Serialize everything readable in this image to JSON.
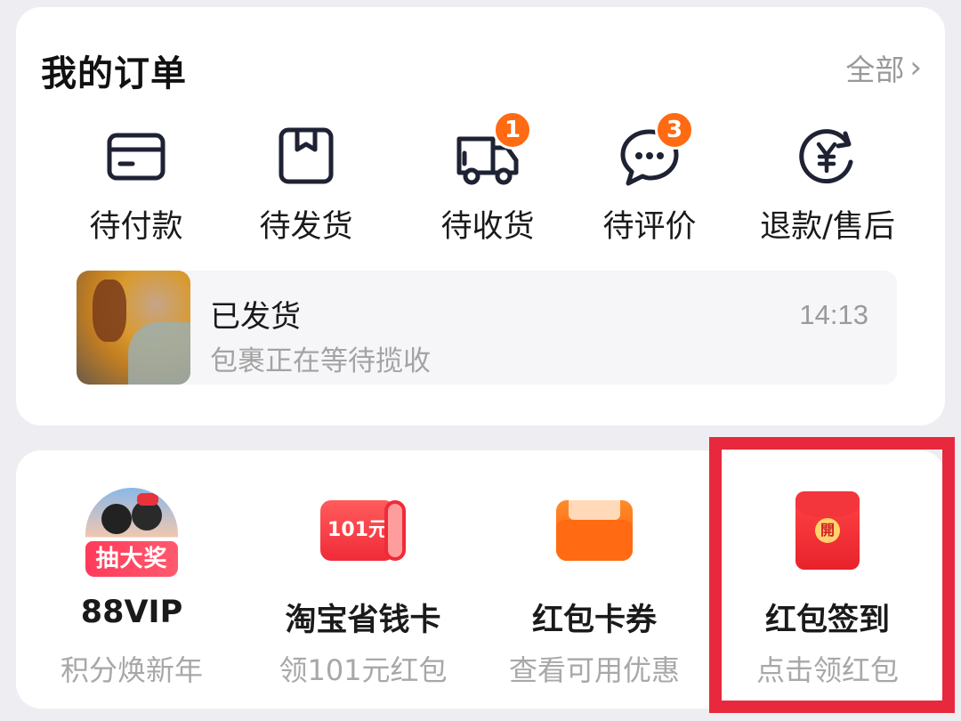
{
  "orders": {
    "title": "我的订单",
    "see_all": "全部",
    "statuses": [
      {
        "label": "待付款",
        "icon": "card-icon"
      },
      {
        "label": "待发货",
        "icon": "box-icon"
      },
      {
        "label": "待收货",
        "icon": "truck-icon",
        "badge": "1"
      },
      {
        "label": "待评价",
        "icon": "chat-bubble-icon",
        "badge": "3"
      },
      {
        "label": "退款/售后",
        "icon": "refund-yen-icon"
      }
    ],
    "latest": {
      "title": "已发货",
      "subtitle": "包裹正在等待揽收",
      "time": "14:13"
    }
  },
  "tools": [
    {
      "name": "88VIP",
      "subtitle": "积分焕新年",
      "icon": "vip-lottery-icon",
      "icon_text": "抽大奖"
    },
    {
      "name": "淘宝省钱卡",
      "subtitle": "领101元红包",
      "icon": "savings-card-icon",
      "icon_text": "101元"
    },
    {
      "name": "红包卡券",
      "subtitle": "查看可用优惠",
      "icon": "wallet-icon"
    },
    {
      "name": "红包签到",
      "subtitle": "点击领红包",
      "icon": "red-envelope-icon",
      "icon_text": "開"
    }
  ],
  "colors": {
    "badge": "#ff6a12",
    "highlight": "#e8283c",
    "text_primary": "#1a1a1a",
    "text_secondary": "#a3a3a3"
  }
}
